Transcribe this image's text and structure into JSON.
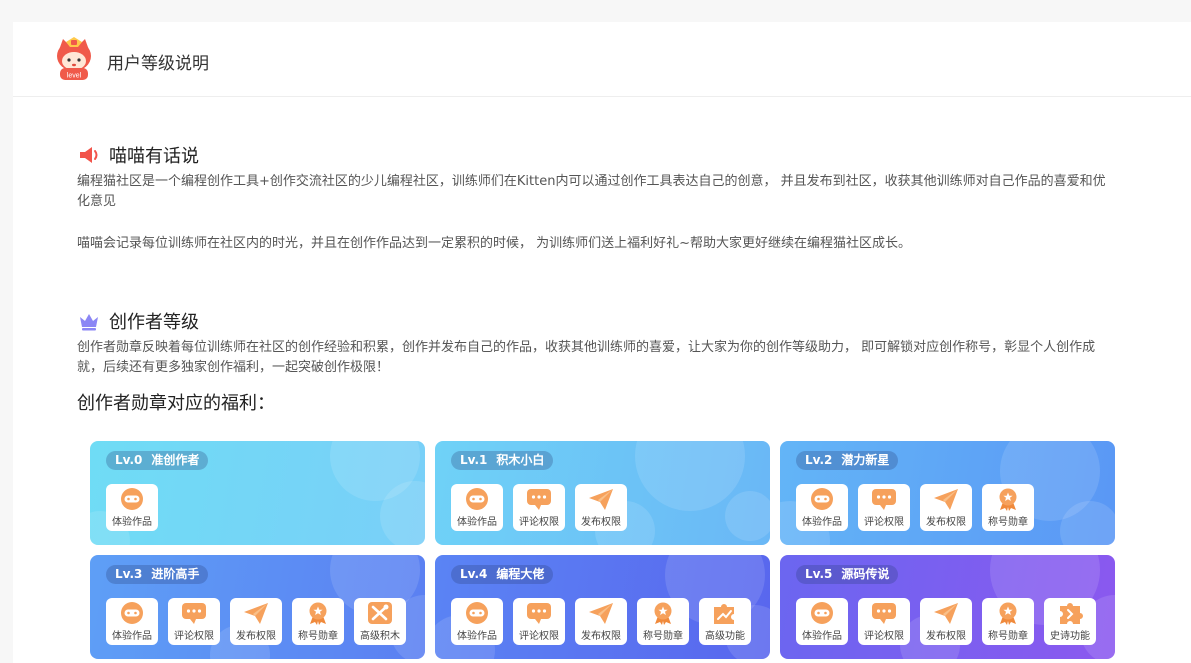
{
  "header": {
    "title": "用户等级说明",
    "logo_text": "level"
  },
  "section1": {
    "title": "喵喵有话说",
    "icon": "speaker-icon",
    "para1": "编程猫社区是一个编程创作工具+创作交流社区的少儿编程社区，训练师们在Kitten内可以通过创作工具表达自己的创意， 并且发布到社区，收获其他训练师对自己作品的喜爱和优化意见",
    "para2": "喵喵会记录每位训练师在社区内的时光，并且在创作作品达到一定累积的时候， 为训练师们送上福利好礼~帮助大家更好继续在编程猫社区成长。"
  },
  "section2": {
    "title": "创作者等级",
    "icon": "crown-icon",
    "para": "创作者勋章反映着每位训练师在社区的创作经验和积累，创作并发布自己的作品，收获其他训练师的喜爱，让大家为你的创作等级助力， 即可解锁对应创作称号，彰显个人创作成就，后续还有更多独家创作福利，一起突破创作极限！"
  },
  "benefits_title": "创作者勋章对应的福利：",
  "levels": [
    {
      "lv": "Lv.0",
      "name": "准创作者",
      "perks": [
        {
          "label": "体验作品",
          "icon": "gamepad-icon"
        }
      ]
    },
    {
      "lv": "Lv.1",
      "name": "积木小白",
      "perks": [
        {
          "label": "体验作品",
          "icon": "gamepad-icon"
        },
        {
          "label": "评论权限",
          "icon": "comment-icon"
        },
        {
          "label": "发布权限",
          "icon": "paper-plane-icon"
        }
      ]
    },
    {
      "lv": "Lv.2",
      "name": "潜力新星",
      "perks": [
        {
          "label": "体验作品",
          "icon": "gamepad-icon"
        },
        {
          "label": "评论权限",
          "icon": "comment-icon"
        },
        {
          "label": "发布权限",
          "icon": "paper-plane-icon"
        },
        {
          "label": "称号勋章",
          "icon": "medal-icon"
        }
      ]
    },
    {
      "lv": "Lv.3",
      "name": "进阶高手",
      "perks": [
        {
          "label": "体验作品",
          "icon": "gamepad-icon"
        },
        {
          "label": "评论权限",
          "icon": "comment-icon"
        },
        {
          "label": "发布权限",
          "icon": "paper-plane-icon"
        },
        {
          "label": "称号勋章",
          "icon": "medal-icon"
        },
        {
          "label": "高级积木",
          "icon": "tools-icon"
        }
      ]
    },
    {
      "lv": "Lv.4",
      "name": "编程大佬",
      "perks": [
        {
          "label": "体验作品",
          "icon": "gamepad-icon"
        },
        {
          "label": "评论权限",
          "icon": "comment-icon"
        },
        {
          "label": "发布权限",
          "icon": "paper-plane-icon"
        },
        {
          "label": "称号勋章",
          "icon": "medal-icon"
        },
        {
          "label": "高级功能",
          "icon": "puzzle-chart-icon"
        }
      ]
    },
    {
      "lv": "Lv.5",
      "name": "源码传说",
      "perks": [
        {
          "label": "体验作品",
          "icon": "gamepad-icon"
        },
        {
          "label": "评论权限",
          "icon": "comment-icon"
        },
        {
          "label": "发布权限",
          "icon": "paper-plane-icon"
        },
        {
          "label": "称号勋章",
          "icon": "medal-icon"
        },
        {
          "label": "史诗功能",
          "icon": "puzzle-icon"
        }
      ]
    }
  ],
  "colors": {
    "icon_orange": "#f6a15c",
    "speaker_red": "#f2544b",
    "crown_purple": "#8b86f5"
  }
}
